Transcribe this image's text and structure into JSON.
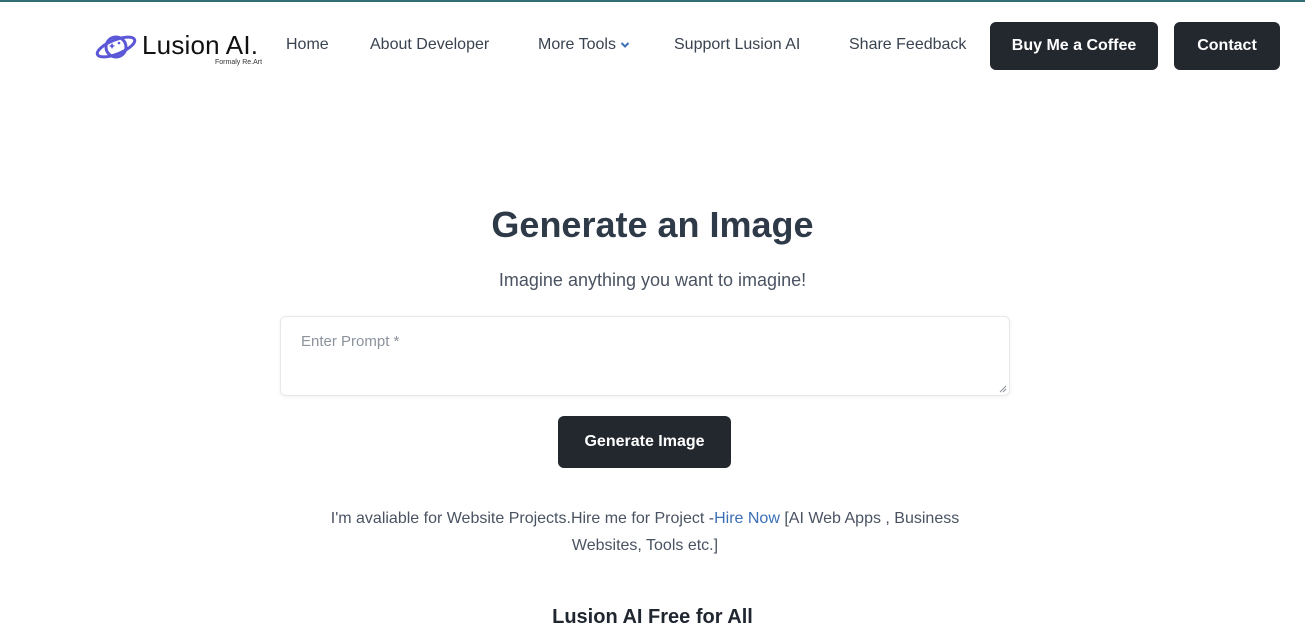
{
  "brand": {
    "name": "Lusion AI.",
    "subtitle": "Formaly Re.Art",
    "accent_color": "#5b57d6"
  },
  "nav": {
    "items": [
      {
        "label": "Home"
      },
      {
        "label": "About Developer"
      },
      {
        "label": "More Tools",
        "icon": "chevron-down-icon"
      },
      {
        "label": "Support Lusion AI"
      },
      {
        "label": "Share Feedback"
      }
    ],
    "buy_coffee_label": "Buy Me a Coffee",
    "contact_label": "Contact"
  },
  "hero": {
    "title": "Generate an Image",
    "subtitle": "Imagine anything you want to imagine!"
  },
  "prompt": {
    "placeholder": "Enter Prompt *",
    "value": ""
  },
  "generate_button_label": "Generate Image",
  "info": {
    "text_before": "I'm avaliable for Website Projects.Hire me for Project -",
    "link_label": "Hire Now",
    "text_after": " [AI Web Apps , Business Websites, Tools etc.]"
  },
  "next_section_heading": "Lusion AI Free for All"
}
